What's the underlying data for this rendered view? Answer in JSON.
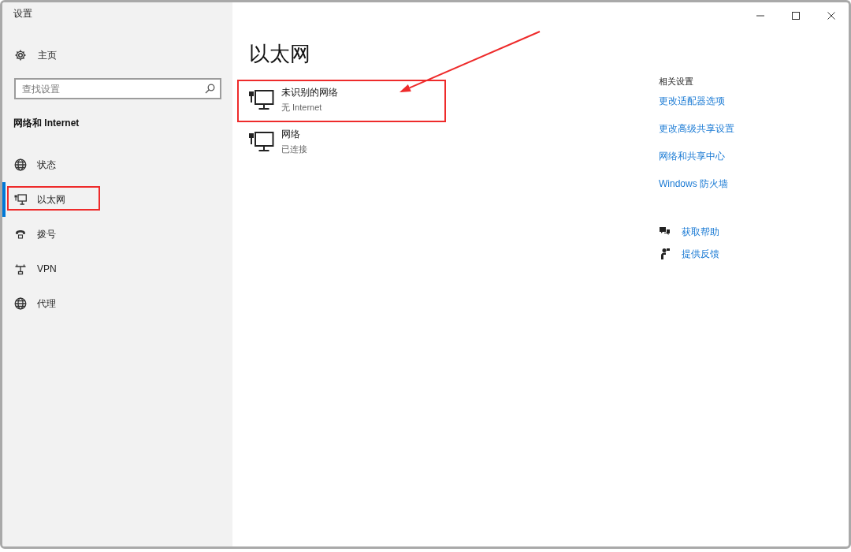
{
  "window": {
    "title": "设置"
  },
  "sidebar": {
    "home": "主页",
    "search": {
      "placeholder": "查找设置"
    },
    "section_title": "网络和 Internet",
    "items": [
      {
        "label": "状态",
        "selected": false,
        "highlighted": false
      },
      {
        "label": "以太网",
        "selected": true,
        "highlighted": true
      },
      {
        "label": "拨号",
        "selected": false,
        "highlighted": false
      },
      {
        "label": "VPN",
        "selected": false,
        "highlighted": false
      },
      {
        "label": "代理",
        "selected": false,
        "highlighted": false
      }
    ]
  },
  "main": {
    "title": "以太网",
    "networks": [
      {
        "name": "未识别的网络",
        "status": "无 Internet",
        "highlighted": true,
        "arrow": true
      },
      {
        "name": "网络",
        "status": "已连接",
        "highlighted": false,
        "arrow": false
      }
    ]
  },
  "related_settings": {
    "title": "相关设置",
    "links": [
      "更改适配器选项",
      "更改高级共享设置",
      "网络和共享中心",
      "Windows 防火墙"
    ]
  },
  "support": [
    {
      "label": "获取帮助"
    },
    {
      "label": "提供反馈"
    }
  ]
}
